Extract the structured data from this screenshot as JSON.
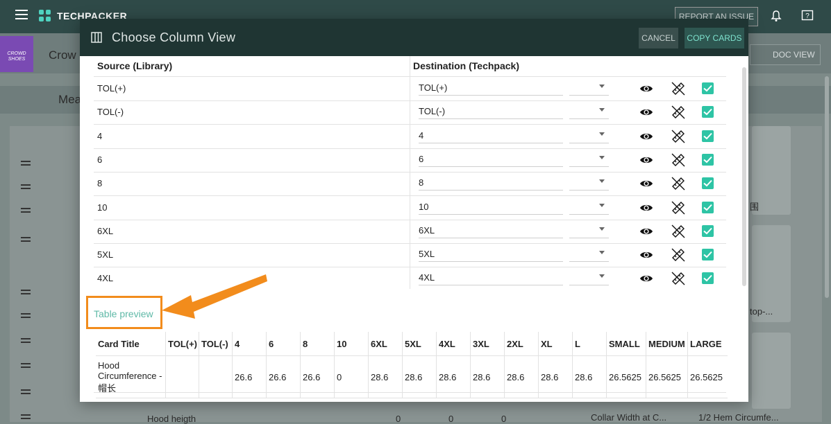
{
  "app": {
    "brand": "TECHPACKER",
    "report_button": "REPORT AN ISSUE",
    "project_thumb_text": "CROWD SHOES",
    "project_name": "Crow",
    "doc_view": "DOC VIEW",
    "meas_label": "Mea",
    "bg_right_text_1": "围",
    "bg_right_text_2": "top-...",
    "hood_row_label": "Hood heigth",
    "bg_value_1": "0",
    "bg_value_2": "0",
    "bg_value_3": "0",
    "collar_label": "Collar Width at C...",
    "hem_label": "1/2 Hem Circumfe..."
  },
  "modal": {
    "title": "Choose Column View",
    "cancel": "CANCEL",
    "copy_cards": "COPY CARDS",
    "source_header": "Source (Library)",
    "destination_header": "Destination (Techpack)",
    "rows": [
      {
        "source": "TOL(+)",
        "destination": "TOL(+)",
        "checked": true
      },
      {
        "source": "TOL(-)",
        "destination": "TOL(-)",
        "checked": true
      },
      {
        "source": "4",
        "destination": "4",
        "checked": true
      },
      {
        "source": "6",
        "destination": "6",
        "checked": true
      },
      {
        "source": "8",
        "destination": "8",
        "checked": true
      },
      {
        "source": "10",
        "destination": "10",
        "checked": true
      },
      {
        "source": "6XL",
        "destination": "6XL",
        "checked": true
      },
      {
        "source": "5XL",
        "destination": "5XL",
        "checked": true
      },
      {
        "source": "4XL",
        "destination": "4XL",
        "checked": true
      }
    ],
    "preview_label": "Table preview",
    "preview": {
      "headers": [
        "Card Title",
        "TOL(+)",
        "TOL(-)",
        "4",
        "6",
        "8",
        "10",
        "6XL",
        "5XL",
        "4XL",
        "3XL",
        "2XL",
        "XL",
        "L",
        "SMALL",
        "MEDIUM",
        "LARGE"
      ],
      "row": [
        "Hood Circumference - 帽长",
        "",
        "",
        "26.6",
        "26.6",
        "26.6",
        "0",
        "28.6",
        "28.6",
        "28.6",
        "28.6",
        "28.6",
        "28.6",
        "28.6",
        "26.5625",
        "26.5625",
        "26.5625"
      ]
    }
  },
  "colors": {
    "header_bg": "#1f3533",
    "accent": "#2ec4a5",
    "callout": "#f28c1c",
    "preview_link": "#5fb9a7"
  }
}
